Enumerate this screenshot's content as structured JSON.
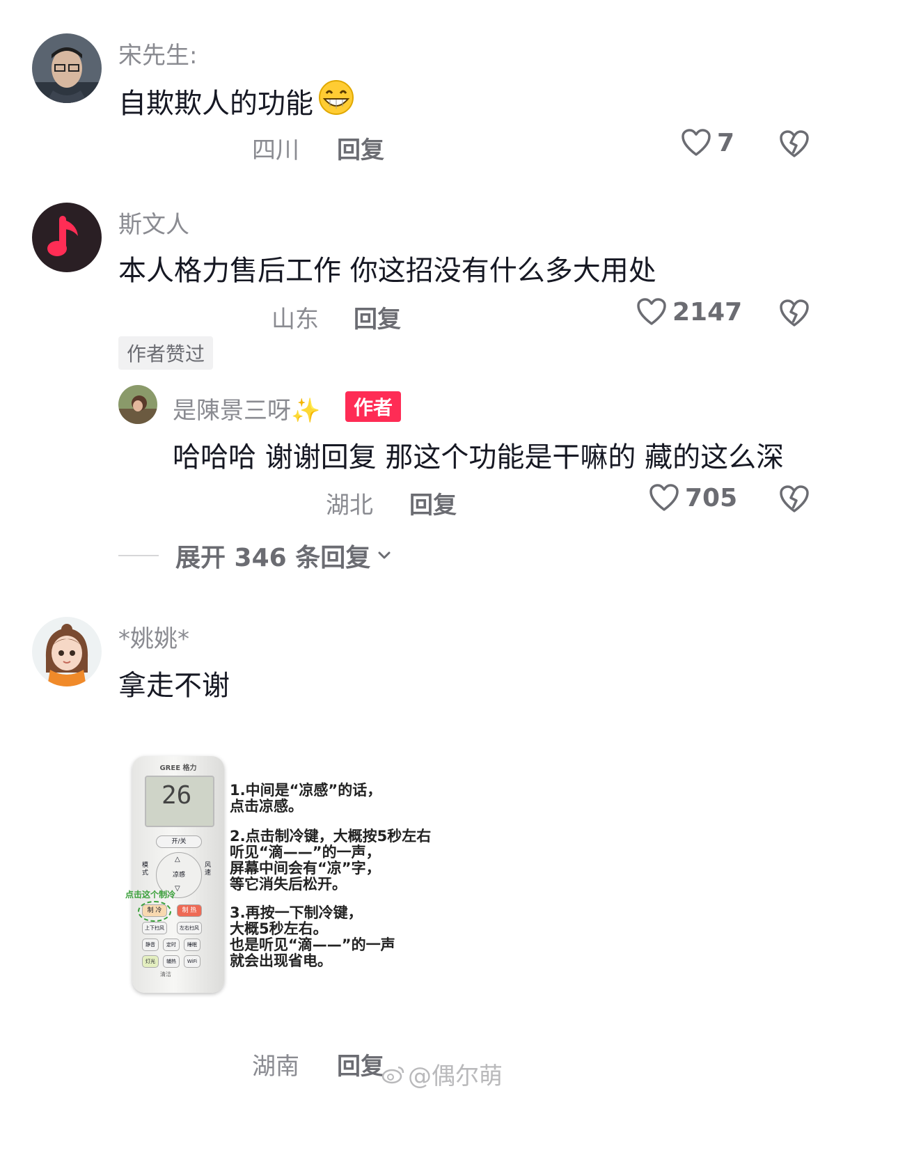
{
  "comments": [
    {
      "username": "宋先生:",
      "text": "自欺欺人的功能",
      "emoji": "grinning-face-icon",
      "location": "四川",
      "reply_label": "回复",
      "likes": "7"
    },
    {
      "username": "斯文人",
      "text": "本人格力售后工作   你这招没有什么多大用处",
      "location": "山东",
      "reply_label": "回复",
      "likes": "2147",
      "author_liked_badge": "作者赞过",
      "replies": [
        {
          "username": "是陳景三呀✨",
          "author_badge": "作者",
          "text": "哈哈哈 谢谢回复 那这个功能是干嘛的 藏的这么深",
          "location": "湖北",
          "reply_label": "回复",
          "likes": "705"
        }
      ],
      "expand_label": "展开 346 条回复"
    },
    {
      "username": "*姚姚*",
      "text": "拿走不谢",
      "location": "湖南",
      "reply_label": "回复",
      "image": {
        "remote_brand": "GREE 格力",
        "remote_display": "26",
        "annotation": "点击这个制冷",
        "keys": {
          "power": "开/关",
          "mode": "模式",
          "cool_feel": "凉感",
          "fan": "风速",
          "cool": "制 冷",
          "heat": "制 热",
          "swing_ud": "上下扫风",
          "swing_lr": "左右扫风",
          "sleep_a": "静音",
          "timer": "定时",
          "sleep": "睡眠",
          "light": "灯光",
          "aux_heat": "辅热",
          "wifi": "WiFi",
          "clean": "清洁"
        },
        "instructions": [
          "1.中间是“凉感”的话，\n点击凉感。",
          "2.点击制冷键，大概按5秒左右\n听见“滴——”的一声，\n屏幕中间会有“凉”字，\n等它消失后松开。",
          "3.再按一下制冷键，\n大概5秒左右。\n也是听见“滴——”的一声\n就会出现省电。"
        ]
      }
    }
  ],
  "watermark": "@偶尔萌",
  "colors": {
    "accent_red": "#fe2c55",
    "gray_text": "#8a8b91",
    "dark_text": "#161823",
    "annotation_green": "#3aa03a"
  }
}
